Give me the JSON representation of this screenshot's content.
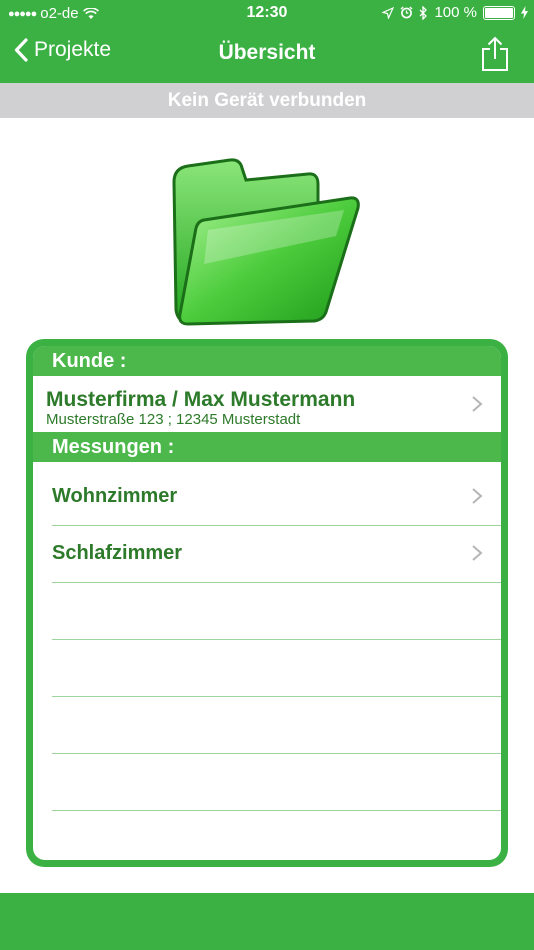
{
  "status_bar": {
    "signal": "●●●●●",
    "carrier": "o2-de",
    "time": "12:30",
    "battery_percent": "100 %",
    "battery_level": 1.0
  },
  "nav": {
    "back_label": "Projekte",
    "title": "Übersicht"
  },
  "connection_status": "Kein Gerät verbunden",
  "customer_section": {
    "header": "Kunde :",
    "name": "Musterfirma / Max Mustermann",
    "address": "Musterstraße 123 ; 12345 Musterstadt"
  },
  "measurements_section": {
    "header": "Messungen :",
    "items": [
      {
        "label": "Wohnzimmer"
      },
      {
        "label": "Schlafzimmer"
      },
      {
        "label": ""
      },
      {
        "label": ""
      },
      {
        "label": ""
      },
      {
        "label": ""
      },
      {
        "label": ""
      }
    ]
  },
  "colors": {
    "brand_green": "#3bb143",
    "text_green": "#2d7a2a",
    "banner_gray": "#d0d0d2"
  },
  "icons": {
    "back": "chevron-left-icon",
    "share": "share-icon",
    "folder": "folder-icon",
    "disclosure": "chevron-right-icon"
  }
}
